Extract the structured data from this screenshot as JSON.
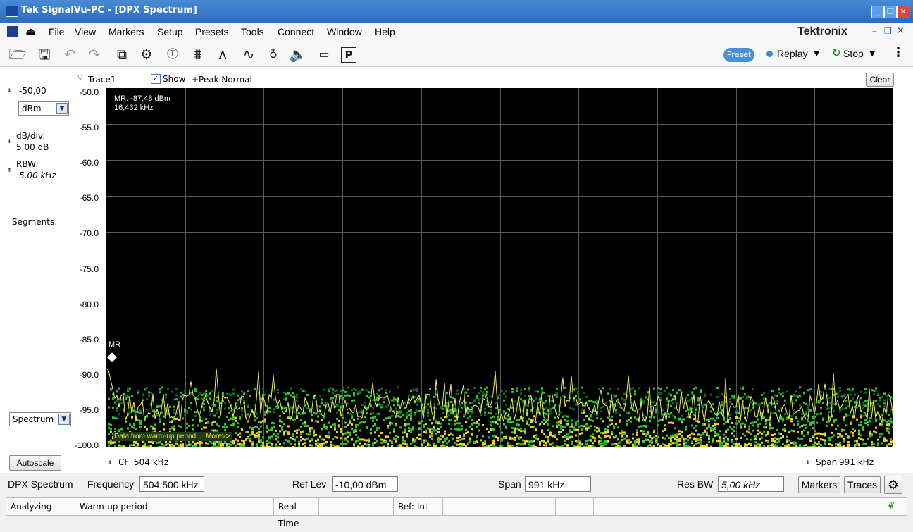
{
  "window": {
    "title": "Tek SignalVu-PC - [DPX Spectrum]"
  },
  "menubar": {
    "items": [
      "File",
      "View",
      "Markers",
      "Setup",
      "Presets",
      "Tools",
      "Connect",
      "Window",
      "Help"
    ],
    "brand": "Tektronix"
  },
  "toolbar": {
    "preset_label": "Preset",
    "replay_label": "Replay",
    "stop_label": "Stop"
  },
  "trace_bar": {
    "trace_name": "Trace1",
    "show_label": "Show",
    "show_checked": true,
    "detector": "+Peak Normal",
    "clear_label": "Clear"
  },
  "left_panel": {
    "ref_value": "-50,00",
    "unit": "dBm",
    "dbdiv_label": "dB/div:",
    "dbdiv_value": "5,00 dB",
    "rbw_label": "RBW:",
    "rbw_value": "5,00 kHz",
    "segments_label": "Segments:",
    "segments_value": "---",
    "mode": "Spectrum",
    "autoscale_label": "Autoscale"
  },
  "plot": {
    "y_ticks": [
      "-50.0",
      "-55.0",
      "-60.0",
      "-65.0",
      "-70.0",
      "-75.0",
      "-80.0",
      "-85.0",
      "-90.0",
      "-95.0",
      "-100.0"
    ],
    "marker_readout_line1": "MR: -87,48 dBm",
    "marker_readout_line2": "16,432 kHz",
    "marker_label": "MR",
    "warmup_note": "Data from warm-up period ... More>>",
    "cf_label": "CF",
    "cf_value": "504 kHz",
    "span_label": "Span",
    "span_value": "991 kHz",
    "colors": {
      "trace": "#e8f06a",
      "dense": "#f0d020",
      "mid": "#30c030",
      "sparse": "#0a6a1a"
    }
  },
  "settings_bar": {
    "view_name": "DPX Spectrum",
    "frequency_label": "Frequency",
    "frequency_value": "504,500 kHz",
    "reflev_label": "Ref Lev",
    "reflev_value": "-10,00 dBm",
    "span_label": "Span",
    "span_value": "991 kHz",
    "resbw_label": "Res BW",
    "resbw_value": "5,00 kHz",
    "markers_button": "Markers",
    "traces_button": "Traces"
  },
  "statusbar": {
    "status": "Analyzing",
    "message": "Warm-up period",
    "mode": "Real Time",
    "ref": "Ref: Int"
  }
}
